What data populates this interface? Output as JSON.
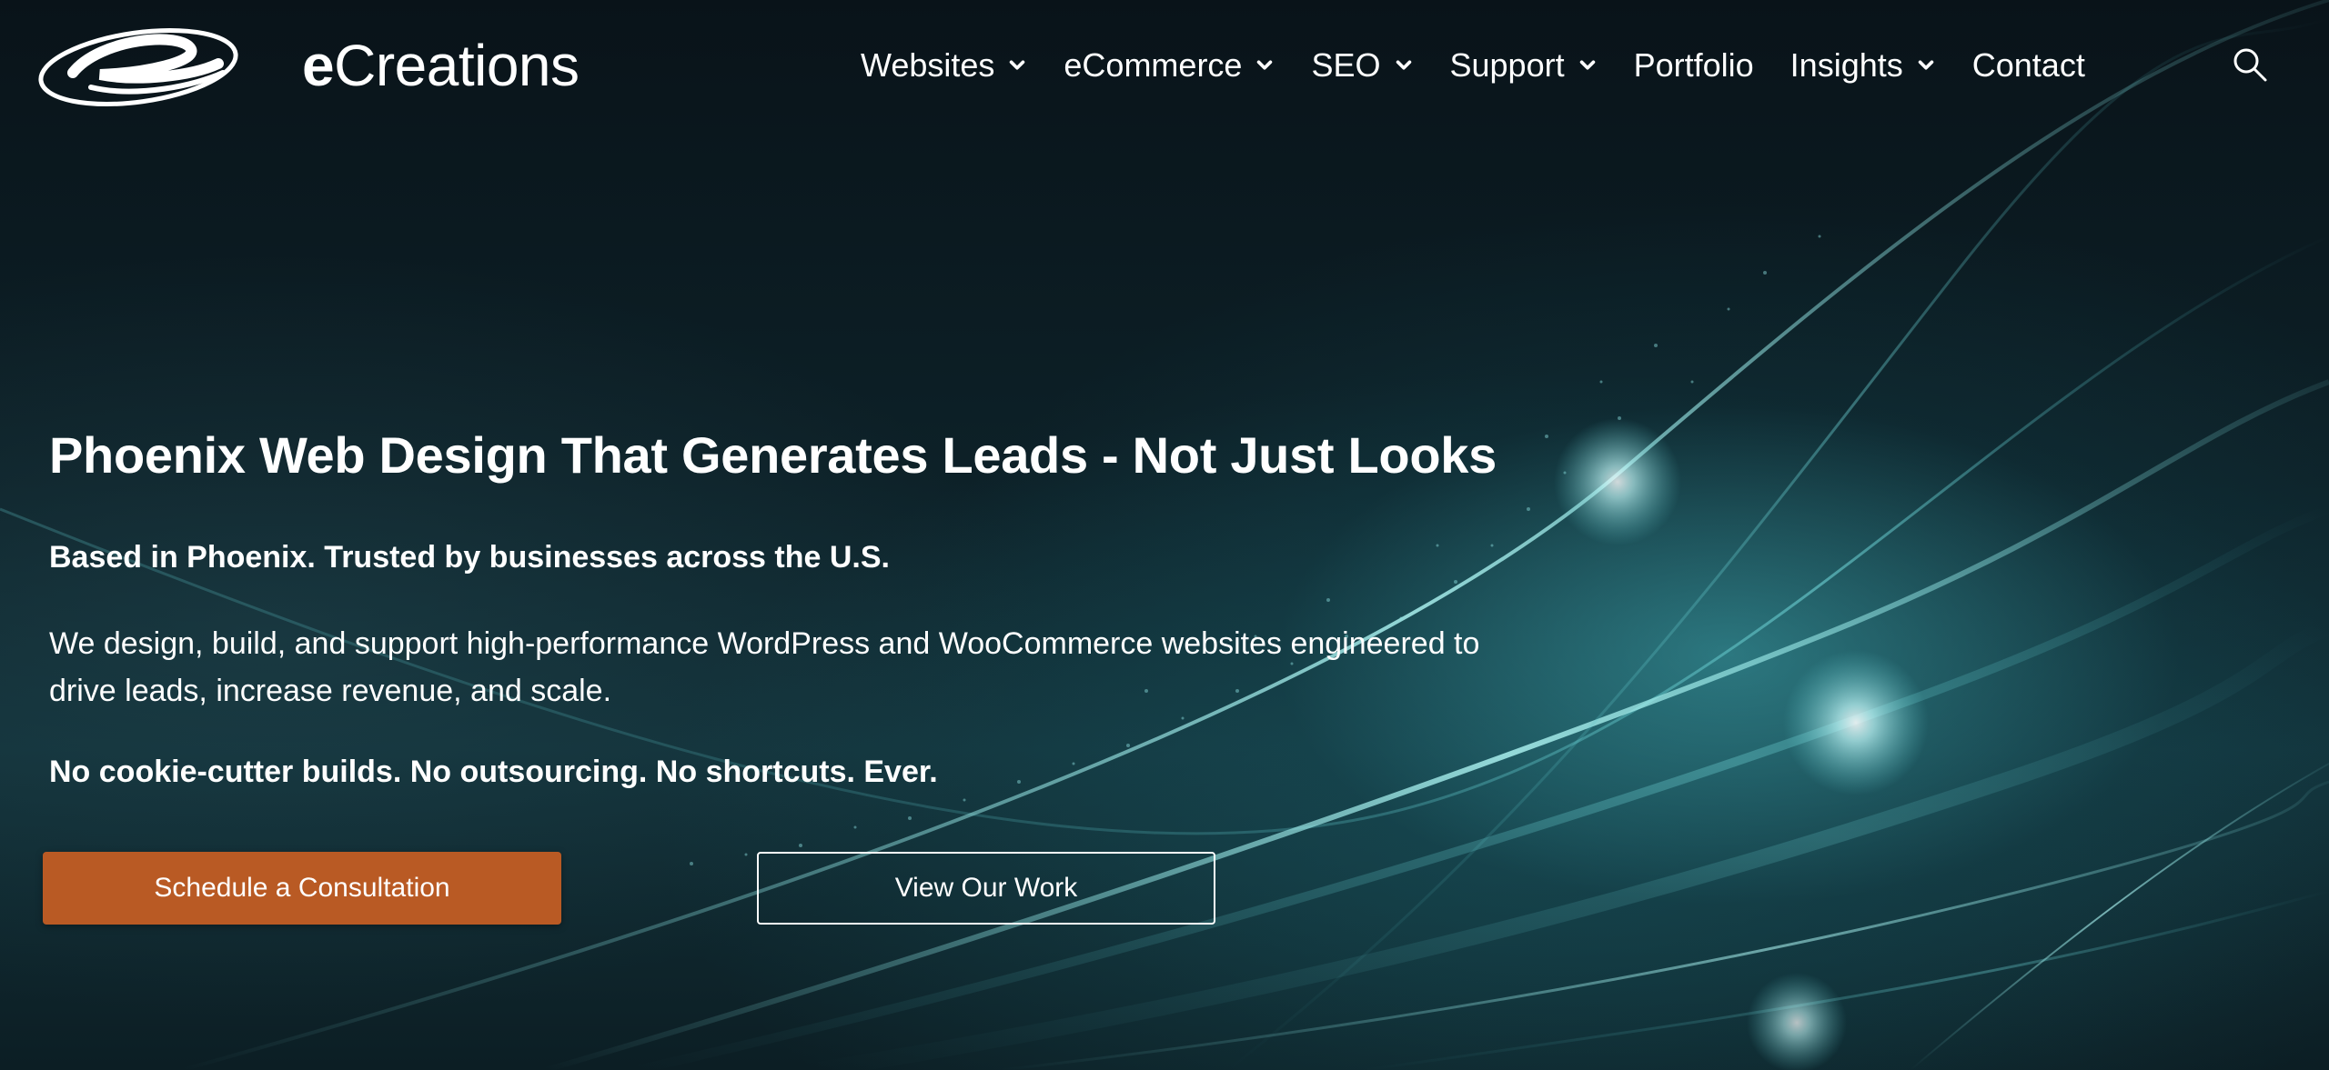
{
  "header": {
    "logo_text_bold": "e",
    "logo_text_rest": "Creations",
    "logo_icon": "ecreations-swoosh-logo"
  },
  "nav": {
    "items": [
      {
        "label": "Websites",
        "has_dropdown": true
      },
      {
        "label": "eCommerce",
        "has_dropdown": true
      },
      {
        "label": "SEO",
        "has_dropdown": true
      },
      {
        "label": "Support",
        "has_dropdown": true
      },
      {
        "label": "Portfolio",
        "has_dropdown": false
      },
      {
        "label": "Insights",
        "has_dropdown": true
      },
      {
        "label": "Contact",
        "has_dropdown": false
      }
    ],
    "search_icon": "search-icon"
  },
  "hero": {
    "title": "Phoenix Web Design That Generates Leads - Not Just Looks",
    "subtitle": "Based in Phoenix. Trusted by businesses across the U.S.",
    "body_line1": "We design, build, and support high-performance WordPress and WooCommerce websites engineered to",
    "body_line2": "drive leads, increase revenue, and scale.",
    "tagline": "No cookie-cutter builds. No outsourcing. No shortcuts. Ever.",
    "primary_cta": "Schedule a Consultation",
    "secondary_cta": "View Our Work"
  },
  "colors": {
    "primary_button": "#b95a24",
    "background_dark": "#0a1a20",
    "accent_teal": "#5cc8cc",
    "text": "#ffffff"
  }
}
